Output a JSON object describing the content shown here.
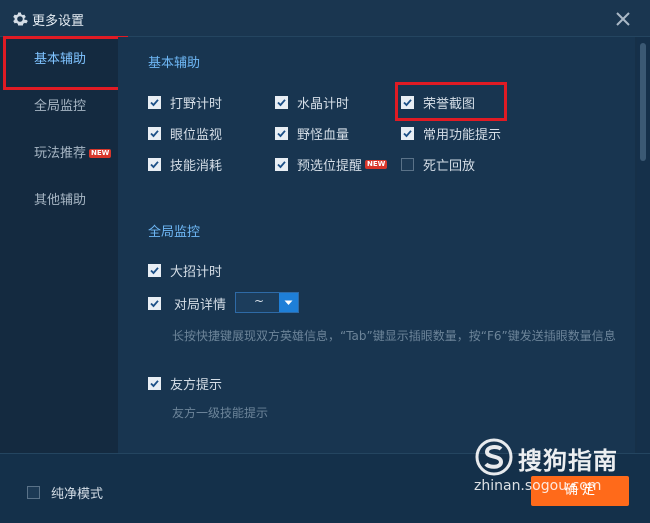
{
  "window": {
    "title": "更多设置",
    "icons": {
      "title": "gear-icon",
      "close": "close-icon"
    }
  },
  "sidebar": {
    "items": [
      {
        "label": "基本辅助",
        "active": true
      },
      {
        "label": "全局监控",
        "active": false
      },
      {
        "label": "玩法推荐",
        "active": false,
        "badge": "NEW"
      },
      {
        "label": "其他辅助",
        "active": false
      }
    ]
  },
  "basic": {
    "title": "基本辅助",
    "options": [
      {
        "label": "打野计时",
        "checked": true
      },
      {
        "label": "水晶计时",
        "checked": true
      },
      {
        "label": "荣誉截图",
        "checked": true
      },
      {
        "label": "眼位监视",
        "checked": true
      },
      {
        "label": "野怪血量",
        "checked": true
      },
      {
        "label": "常用功能提示",
        "checked": true
      },
      {
        "label": "技能消耗",
        "checked": true
      },
      {
        "label": "预选位提醒",
        "checked": true,
        "badge": "NEW"
      },
      {
        "label": "死亡回放",
        "checked": false
      }
    ]
  },
  "monitor": {
    "title": "全局监控",
    "ult_timer": {
      "label": "大招计时",
      "checked": true
    },
    "match_detail": {
      "label": "对局详情",
      "checked": true,
      "dropdown_value": "~",
      "hint": "长按快捷键展现双方英雄信息，“Tab”键显示插眼数量，按“F6”键发送插眼数量信息"
    },
    "ally_tip": {
      "label": "友方提示",
      "checked": true,
      "hint": "友方一级技能提示"
    }
  },
  "footer": {
    "pure_mode": {
      "label": "纯净模式",
      "checked": false
    },
    "confirm_label": "确 定"
  },
  "watermark": {
    "brand": "搜狗指南",
    "url": "zhinan.sogou.com"
  },
  "colors": {
    "accent": "#6eb7f5",
    "highlight_box": "#e01b24",
    "confirm": "#ff6a1a",
    "badge": "#d8372b"
  }
}
